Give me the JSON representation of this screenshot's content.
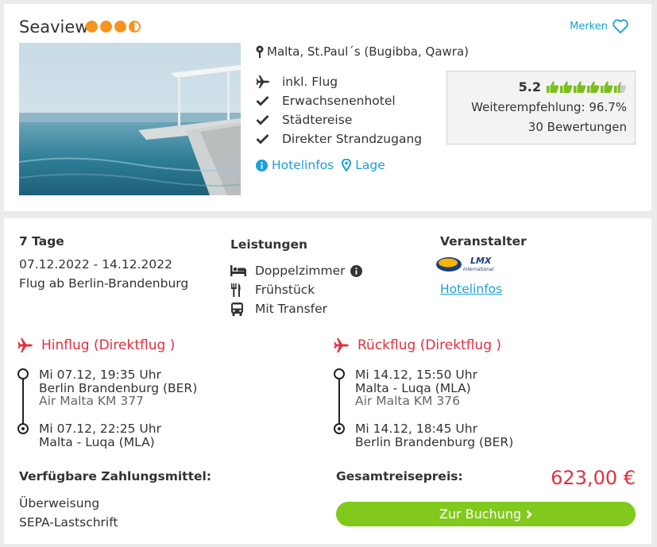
{
  "hotel": {
    "name": "Seaview",
    "stars": 3.5,
    "merken_label": "Merken",
    "location": "Malta, St.Paul´s (Bugibba, Qawra)",
    "features": [
      "inkl. Flug",
      "Erwachsenenhotel",
      "Städtereise",
      "Direkter Strandzugang"
    ],
    "link_hotelinfos": "Hotelinfos",
    "link_lage": "Lage",
    "rating": {
      "score": "5.2",
      "thumbs_filled": 5.5,
      "thumbs_total": 6,
      "recommendation": "Weiterempfehlung: 96.7%",
      "reviews": "30 Bewertungen"
    }
  },
  "trip": {
    "duration": "7 Tage",
    "dates": "07.12.2022 - 14.12.2022",
    "departure": "Flug ab Berlin-Brandenburg"
  },
  "leistungen": {
    "title": "Leistungen",
    "items": [
      "Doppelzimmer",
      "Frühstück",
      "Mit Transfer"
    ]
  },
  "veranstalter": {
    "title": "Veranstalter",
    "logo_text": "LMX",
    "logo_sub": "International",
    "link": "Hotelinfos"
  },
  "hinflug": {
    "title": "Hinflug (Direktflug )",
    "dep_time": "Mi 07.12, 19:35 Uhr",
    "dep_airport": "Berlin Brandenburg (BER)",
    "flight": "Air Malta KM 377",
    "arr_time": "Mi 07.12, 22:25 Uhr",
    "arr_airport": "Malta - Luqa (MLA)"
  },
  "rueckflug": {
    "title": "Rückflug (Direktflug )",
    "dep_time": "Mi 14.12, 15:50 Uhr",
    "dep_airport": "Malta - Luqa (MLA)",
    "flight": "Air Malta KM 376",
    "arr_time": "Mi 14.12, 18:45 Uhr",
    "arr_airport": "Berlin Brandenburg (BER)"
  },
  "payment": {
    "title": "Verfügbare Zahlungsmittel:",
    "methods": [
      "Überweisung",
      "SEPA-Lastschrift"
    ]
  },
  "price": {
    "label": "Gesamtreisepreis:",
    "value": "623,00 €"
  },
  "booking_button": "Zur Buchung",
  "colors": {
    "accent_blue": "#1ba0d8",
    "star_orange": "#f7941d",
    "flight_red": "#e2303f",
    "button_green": "#82c91e",
    "thumb_green": "#7cbf1b"
  }
}
